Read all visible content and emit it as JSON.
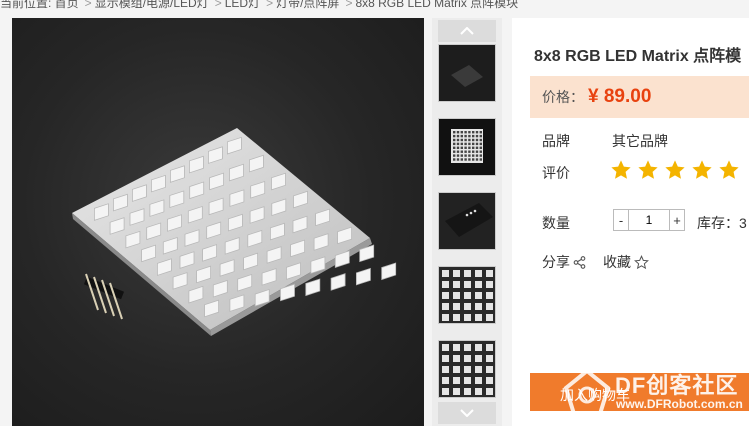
{
  "breadcrumb": {
    "items": [
      "当前位置: 首页",
      "显示模组/电源/LED灯",
      "LED灯",
      "灯带/点阵屏",
      "8x8 RGB LED Matrix 点阵模块"
    ]
  },
  "gallery": {
    "main_image_alt": "8x8 RGB LED Matrix",
    "thumbnail_count": 5
  },
  "product": {
    "title": "8x8 RGB LED Matrix 点阵模",
    "price_label": "价格：",
    "price": "¥ 89.00",
    "brand_label": "品牌",
    "brand_value": "其它品牌",
    "rating_label": "评价",
    "rating": 5,
    "rating_max": 5,
    "quantity_label": "数量",
    "quantity": "1",
    "minus_label": "-",
    "plus_label": "+",
    "stock_label": "库存：3",
    "share_label": "分享",
    "favorite_label": "收藏",
    "cart_label": "加入购物车",
    "accent_color": "#e8420f",
    "star_color": "#f4b400"
  },
  "watermark": {
    "line1": "DF创客社区",
    "line2": "www.DFRobot.com.cn"
  }
}
